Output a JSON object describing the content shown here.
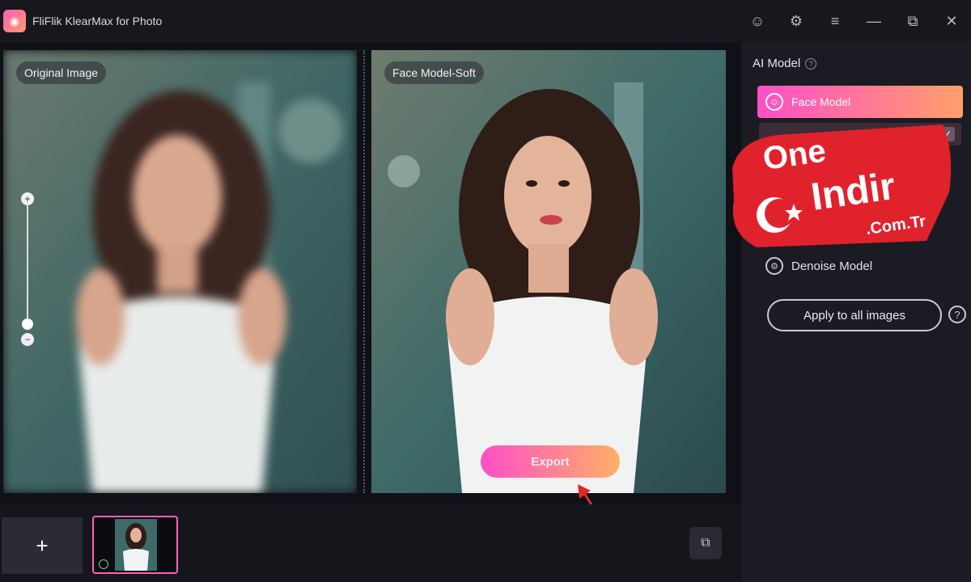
{
  "app": {
    "title": "FliFlik KlearMax for Photo",
    "logo_icon": "app-logo-icon"
  },
  "titlebar": {
    "icons": [
      "user-icon",
      "gift-icon",
      "menu-icon",
      "minimize-icon",
      "maximize-icon",
      "close-icon"
    ],
    "glyphs": [
      "☺",
      "⚙",
      "≡",
      "—",
      "⧉",
      "✕"
    ]
  },
  "canvas": {
    "left_label": "Original Image",
    "right_label": "Face Model-Soft",
    "zoom_in": "+",
    "zoom_out": "−"
  },
  "export": {
    "label": "Export"
  },
  "strip": {
    "add_label": "+",
    "copy_icon": "⧉"
  },
  "sidebar": {
    "header": "AI Model",
    "help": "?",
    "face_model": "Face Model",
    "face_icon": "☺",
    "check_glyph": "✓",
    "denoise_model": "Denoise Model",
    "denoise_icon": "⚙",
    "apply_all": "Apply to all images",
    "apply_help": "?"
  },
  "watermark": {
    "line1": "One",
    "line2": "Indir",
    "line3": ".Com.Tr"
  },
  "colors": {
    "accent_start": "#ff4fc7",
    "accent_end": "#ffb067",
    "background": "#15161c",
    "sidebar": "#1b1c23"
  }
}
